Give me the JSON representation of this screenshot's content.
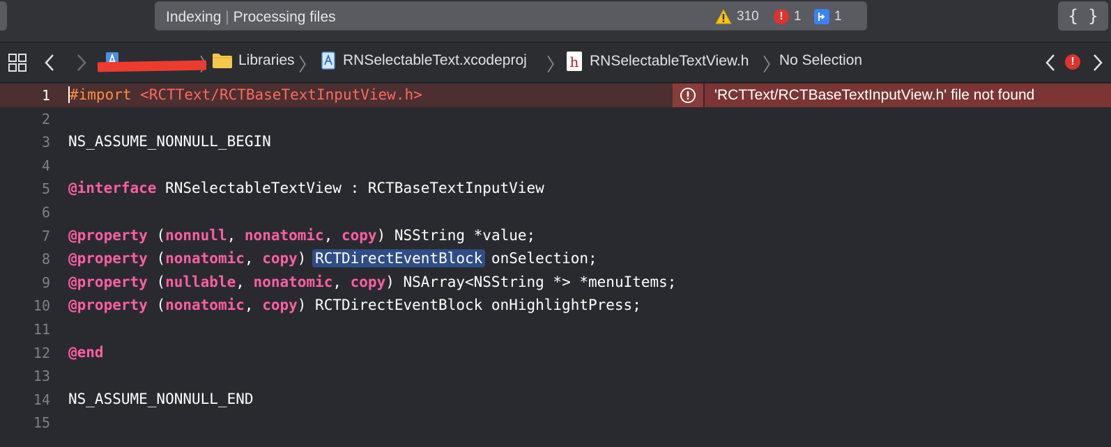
{
  "toolbar": {
    "activity_app": "Indexing",
    "activity_separator": "|",
    "activity_status": "Processing files",
    "warnings_count": "310",
    "errors_count": "1",
    "analyzer_count": "1",
    "warning_icon": "warning-triangle-icon",
    "error_icon": "error-circle-icon",
    "analyzer_icon": "analyzer-icon",
    "braces_label": "{ }",
    "colors": {
      "warning": "#f5c518",
      "error": "#e0322f",
      "analyzer": "#3b82f6"
    }
  },
  "jumpbar": {
    "back_label": "‹",
    "forward_label": "›",
    "crumbs": [
      {
        "label": "",
        "icon": "project-icon"
      },
      {
        "label": "Libraries",
        "icon": "folder-icon"
      },
      {
        "label": "RNSelectableText.xcodeproj",
        "icon": "xcodeproj-icon"
      },
      {
        "label": "RNSelectableTextView.h",
        "icon": "header-file-icon"
      },
      {
        "label": "No Selection",
        "icon": ""
      }
    ]
  },
  "editor": {
    "error_message": "'RCTText/RCTBaseTextInputView.h' file not found",
    "lines": [
      {
        "n": "1",
        "tokens": [
          [
            "pp",
            "#import "
          ],
          [
            "str",
            "<RCTText/RCTBaseTextInputView.h>"
          ]
        ]
      },
      {
        "n": "2",
        "tokens": []
      },
      {
        "n": "3",
        "tokens": [
          [
            "plain",
            "NS_ASSUME_NONNULL_BEGIN"
          ]
        ]
      },
      {
        "n": "4",
        "tokens": []
      },
      {
        "n": "5",
        "tokens": [
          [
            "kw",
            "@interface"
          ],
          [
            "plain",
            " RNSelectableTextView : RCTBaseTextInputView"
          ]
        ]
      },
      {
        "n": "6",
        "tokens": []
      },
      {
        "n": "7",
        "tokens": [
          [
            "kw",
            "@property"
          ],
          [
            "plain",
            " ("
          ],
          [
            "kw",
            "nonnull"
          ],
          [
            "plain",
            ", "
          ],
          [
            "kw",
            "nonatomic"
          ],
          [
            "plain",
            ", "
          ],
          [
            "kw",
            "copy"
          ],
          [
            "plain",
            ") NSString *value;"
          ]
        ]
      },
      {
        "n": "8",
        "tokens": [
          [
            "kw",
            "@property"
          ],
          [
            "plain",
            " ("
          ],
          [
            "kw",
            "nonatomic"
          ],
          [
            "plain",
            ", "
          ],
          [
            "kw",
            "copy"
          ],
          [
            "plain",
            ") "
          ],
          [
            "sel",
            "RCTDirectEventBlock"
          ],
          [
            "plain",
            " onSelection;"
          ]
        ]
      },
      {
        "n": "9",
        "tokens": [
          [
            "kw",
            "@property"
          ],
          [
            "plain",
            " ("
          ],
          [
            "kw",
            "nullable"
          ],
          [
            "plain",
            ", "
          ],
          [
            "kw",
            "nonatomic"
          ],
          [
            "plain",
            ", "
          ],
          [
            "kw",
            "copy"
          ],
          [
            "plain",
            ") NSArray<NSString *> *menuItems;"
          ]
        ]
      },
      {
        "n": "10",
        "tokens": [
          [
            "kw",
            "@property"
          ],
          [
            "plain",
            " ("
          ],
          [
            "kw",
            "nonatomic"
          ],
          [
            "plain",
            ", "
          ],
          [
            "kw",
            "copy"
          ],
          [
            "plain",
            ") RCTDirectEventBlock onHighlightPress;"
          ]
        ]
      },
      {
        "n": "11",
        "tokens": []
      },
      {
        "n": "12",
        "tokens": [
          [
            "kw",
            "@end"
          ]
        ]
      },
      {
        "n": "13",
        "tokens": []
      },
      {
        "n": "14",
        "tokens": [
          [
            "plain",
            "NS_ASSUME_NONNULL_END"
          ]
        ]
      },
      {
        "n": "15",
        "tokens": []
      }
    ]
  }
}
